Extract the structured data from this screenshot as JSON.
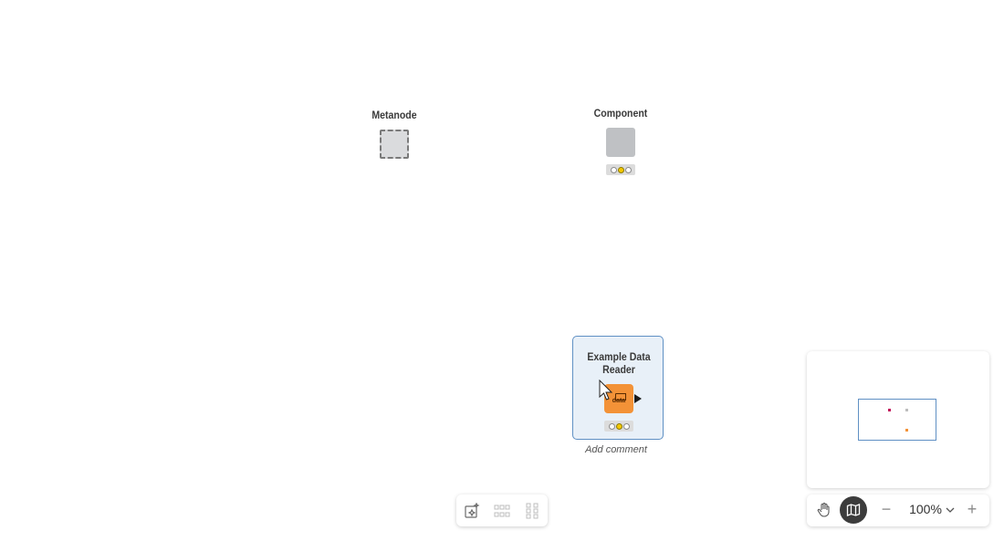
{
  "canvas": {
    "metanode": {
      "label": "Metanode"
    },
    "component": {
      "label": "Component"
    },
    "selected_node": {
      "label": "Example Data Reader",
      "icon_text": "data",
      "comment_placeholder": "Add comment"
    }
  },
  "bottom_toolbar": {
    "buttons": [
      "ai-assistant-icon",
      "align-horizontal-icon",
      "align-vertical-icon"
    ]
  },
  "zoom_controls": {
    "zoom_value": "100%",
    "minus": "−",
    "plus": "+"
  },
  "colors": {
    "selection_border": "#5f90c4",
    "node_orange": "#f39237",
    "status_yellow": "#f5c800"
  }
}
